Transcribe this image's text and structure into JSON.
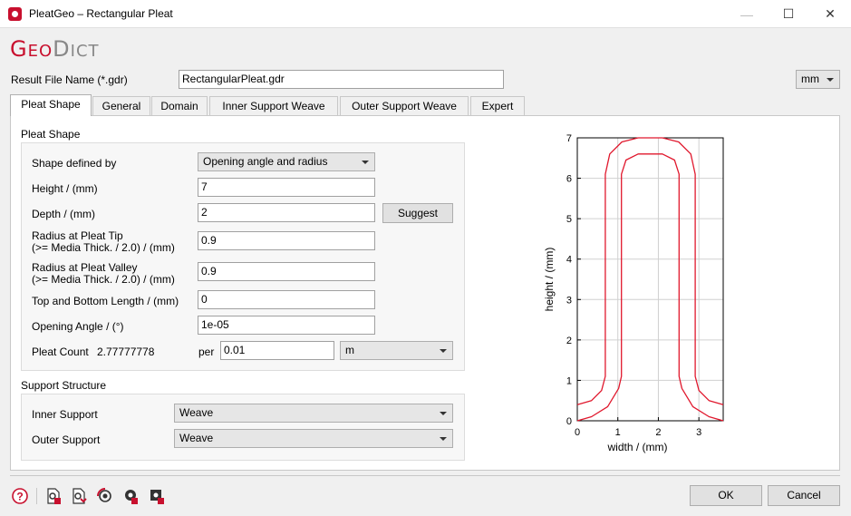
{
  "window": {
    "title": "PleatGeo – Rectangular Pleat",
    "minimize_glyph": "—",
    "maximize_glyph": "☐",
    "close_glyph": "✕"
  },
  "logo": {
    "first_big": "G",
    "first_small": "EO",
    "second_big": "D",
    "second_small": "ICT"
  },
  "result_file": {
    "label": "Result File Name (*.gdr)",
    "value": "RectangularPleat.gdr",
    "unit": "mm"
  },
  "tabs": [
    {
      "label": "Pleat Shape",
      "active": true
    },
    {
      "label": "General"
    },
    {
      "label": "Domain"
    },
    {
      "label": "Inner Support Weave"
    },
    {
      "label": "Outer Support Weave"
    },
    {
      "label": "Expert"
    }
  ],
  "pleat_shape": {
    "section_title": "Pleat Shape",
    "shape_defined_by": {
      "label": "Shape defined by",
      "value": "Opening angle and radius"
    },
    "height": {
      "label": "Height / (mm)",
      "value": "7"
    },
    "depth": {
      "label": "Depth / (mm)",
      "value": "2",
      "suggest_label": "Suggest"
    },
    "radius_tip": {
      "label_line1": "Radius at Pleat Tip",
      "label_line2": "(>= Media Thick. / 2.0) / (mm)",
      "value": "0.9"
    },
    "radius_valley": {
      "label_line1": "Radius at Pleat Valley",
      "label_line2": "(>= Media Thick. / 2.0) / (mm)",
      "value": "0.9"
    },
    "top_bottom_length": {
      "label": "Top and Bottom Length / (mm)",
      "value": "0"
    },
    "opening_angle": {
      "label": "Opening Angle / (°)",
      "value": "1e-05"
    },
    "pleat_count": {
      "label": "Pleat Count",
      "value": "2.77777778",
      "per_label": "per",
      "per_value": "0.01",
      "per_unit": "m"
    }
  },
  "support_structure": {
    "section_title": "Support Structure",
    "inner": {
      "label": "Inner Support",
      "value": "Weave"
    },
    "outer": {
      "label": "Outer Support",
      "value": "Weave"
    }
  },
  "buttons": {
    "ok": "OK",
    "cancel": "Cancel",
    "help_glyph": "?"
  },
  "toolbar_icons": [
    "help-icon",
    "load-settings-icon",
    "save-settings-icon",
    "reset-settings-icon",
    "run-macro-icon",
    "record-macro-icon"
  ],
  "chart_data": {
    "type": "line",
    "xlabel": "width / (mm)",
    "ylabel": "height / (mm)",
    "xlim": [
      0,
      3.6
    ],
    "ylim": [
      0,
      7
    ],
    "xticks": [
      0,
      1,
      2,
      3
    ],
    "yticks": [
      0,
      1,
      2,
      3,
      4,
      5,
      6,
      7
    ],
    "grid": true,
    "color": "#e0182d",
    "series": [
      {
        "points": [
          [
            0,
            0.4
          ],
          [
            0.35,
            0.5
          ],
          [
            0.6,
            0.75
          ],
          [
            0.69,
            1.1
          ],
          [
            0.69,
            6.1
          ],
          [
            0.8,
            6.6
          ],
          [
            1.1,
            6.9
          ],
          [
            1.5,
            7.0
          ],
          [
            1.8,
            7.0
          ],
          [
            2.1,
            7.0
          ],
          [
            2.5,
            6.9
          ],
          [
            2.8,
            6.6
          ],
          [
            2.91,
            6.1
          ],
          [
            2.91,
            1.1
          ],
          [
            3.0,
            0.75
          ],
          [
            3.25,
            0.5
          ],
          [
            3.6,
            0.4
          ]
        ]
      },
      {
        "points": [
          [
            0,
            0
          ],
          [
            0.35,
            0.1
          ],
          [
            0.75,
            0.35
          ],
          [
            1.02,
            0.8
          ],
          [
            1.09,
            1.1
          ],
          [
            1.09,
            6.1
          ],
          [
            1.2,
            6.45
          ],
          [
            1.5,
            6.6
          ],
          [
            1.8,
            6.6
          ],
          [
            2.1,
            6.6
          ],
          [
            2.4,
            6.45
          ],
          [
            2.51,
            6.1
          ],
          [
            2.51,
            1.1
          ],
          [
            2.58,
            0.8
          ],
          [
            2.85,
            0.35
          ],
          [
            3.25,
            0.1
          ],
          [
            3.6,
            0
          ]
        ]
      }
    ]
  }
}
